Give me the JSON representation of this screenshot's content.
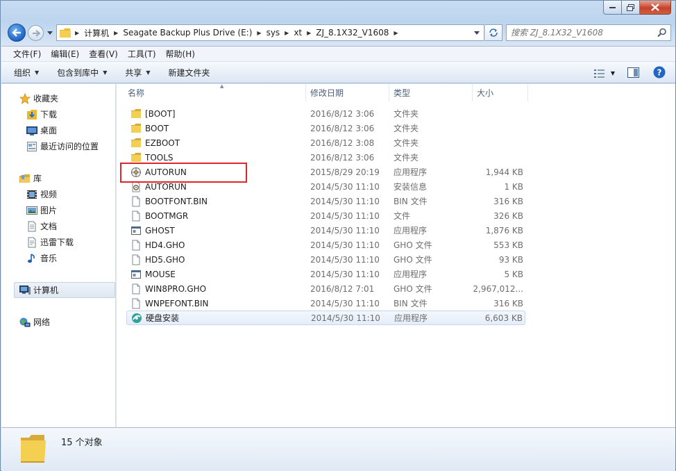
{
  "window": {
    "colors": {
      "accent": "#1d64c6",
      "close": "#c4422a",
      "highlight": "#e0242c",
      "folder": "#e8b931"
    }
  },
  "address_bar": {
    "crumbs": [
      "计算机",
      "Seagate Backup Plus Drive (E:)",
      "sys",
      "xt",
      "ZJ_8.1X32_V1608"
    ]
  },
  "search": {
    "placeholder": "搜索 ZJ_8.1X32_V1608"
  },
  "menu": [
    "文件(F)",
    "编辑(E)",
    "查看(V)",
    "工具(T)",
    "帮助(H)"
  ],
  "commands": {
    "organize": "组织",
    "include_library": "包含到库中",
    "share": "共享",
    "new_folder": "新建文件夹"
  },
  "nav": {
    "favorites": "收藏夹",
    "downloads": "下载",
    "desktop": "桌面",
    "recent": "最近访问的位置",
    "libraries": "库",
    "videos": "视频",
    "pictures": "图片",
    "documents": "文档",
    "thunder": "迅雷下载",
    "music": "音乐",
    "computer": "计算机",
    "network": "网络"
  },
  "columns": {
    "name": "名称",
    "date": "修改日期",
    "type": "类型",
    "size": "大小"
  },
  "files": [
    {
      "name": "[BOOT]",
      "date": "2016/8/12 3:06",
      "type": "文件夹",
      "size": "",
      "icon": "folder-icon"
    },
    {
      "name": "BOOT",
      "date": "2016/8/12 3:06",
      "type": "文件夹",
      "size": "",
      "icon": "folder-icon"
    },
    {
      "name": "EZBOOT",
      "date": "2016/8/12 3:08",
      "type": "文件夹",
      "size": "",
      "icon": "folder-icon"
    },
    {
      "name": "TOOLS",
      "date": "2016/8/12 3:06",
      "type": "文件夹",
      "size": "",
      "icon": "folder-icon"
    },
    {
      "name": "AUTORUN",
      "date": "2015/8/29 20:19",
      "type": "应用程序",
      "size": "1,944 KB",
      "icon": "autorun-app-icon"
    },
    {
      "name": "AUTORUN",
      "date": "2014/5/30 11:10",
      "type": "安装信息",
      "size": "1 KB",
      "icon": "setup-info-icon"
    },
    {
      "name": "BOOTFONT.BIN",
      "date": "2014/5/30 11:10",
      "type": "BIN 文件",
      "size": "316 KB",
      "icon": "file-icon"
    },
    {
      "name": "BOOTMGR",
      "date": "2014/5/30 11:10",
      "type": "文件",
      "size": "326 KB",
      "icon": "file-icon"
    },
    {
      "name": "GHOST",
      "date": "2014/5/30 11:10",
      "type": "应用程序",
      "size": "1,876 KB",
      "icon": "app-window-icon"
    },
    {
      "name": "HD4.GHO",
      "date": "2014/5/30 11:10",
      "type": "GHO 文件",
      "size": "553 KB",
      "icon": "file-icon"
    },
    {
      "name": "HD5.GHO",
      "date": "2014/5/30 11:10",
      "type": "GHO 文件",
      "size": "93 KB",
      "icon": "file-icon"
    },
    {
      "name": "MOUSE",
      "date": "2014/5/30 11:10",
      "type": "应用程序",
      "size": "5 KB",
      "icon": "app-window-icon"
    },
    {
      "name": "WIN8PRO.GHO",
      "date": "2016/8/12 7:01",
      "type": "GHO 文件",
      "size": "2,967,012...",
      "icon": "file-icon"
    },
    {
      "name": "WNPEFONT.BIN",
      "date": "2014/5/30 11:10",
      "type": "BIN 文件",
      "size": "316 KB",
      "icon": "file-icon"
    },
    {
      "name": "硬盘安装",
      "date": "2014/5/30 11:10",
      "type": "应用程序",
      "size": "6,603 KB",
      "icon": "installer-icon"
    }
  ],
  "status": {
    "count": "15 个对象"
  }
}
